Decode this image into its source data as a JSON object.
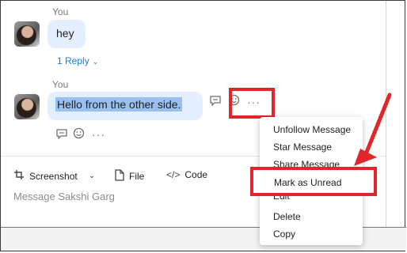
{
  "messages": [
    {
      "sender": "You",
      "text": "hey",
      "reply_label": "1 Reply"
    },
    {
      "sender": "You",
      "text": "Hello from the other side."
    }
  ],
  "composer": {
    "tools": {
      "screenshot": "Screenshot",
      "file": "File",
      "code": "Code"
    },
    "placeholder": "Message Sakshi Garg"
  },
  "context_menu": {
    "items": [
      "Unfollow Message",
      "Star Message",
      "Share Message",
      "Mark as Unread",
      "Edit",
      "Delete",
      "Copy"
    ]
  },
  "colors": {
    "highlight": "#e0262b",
    "bubble": "#e3efff",
    "selection": "#98c1f2",
    "link": "#1f7ae0"
  },
  "icons": [
    "reply-icon",
    "emoji-icon",
    "more-icon",
    "screenshot-icon",
    "file-icon",
    "code-icon",
    "chevron-down-icon"
  ]
}
